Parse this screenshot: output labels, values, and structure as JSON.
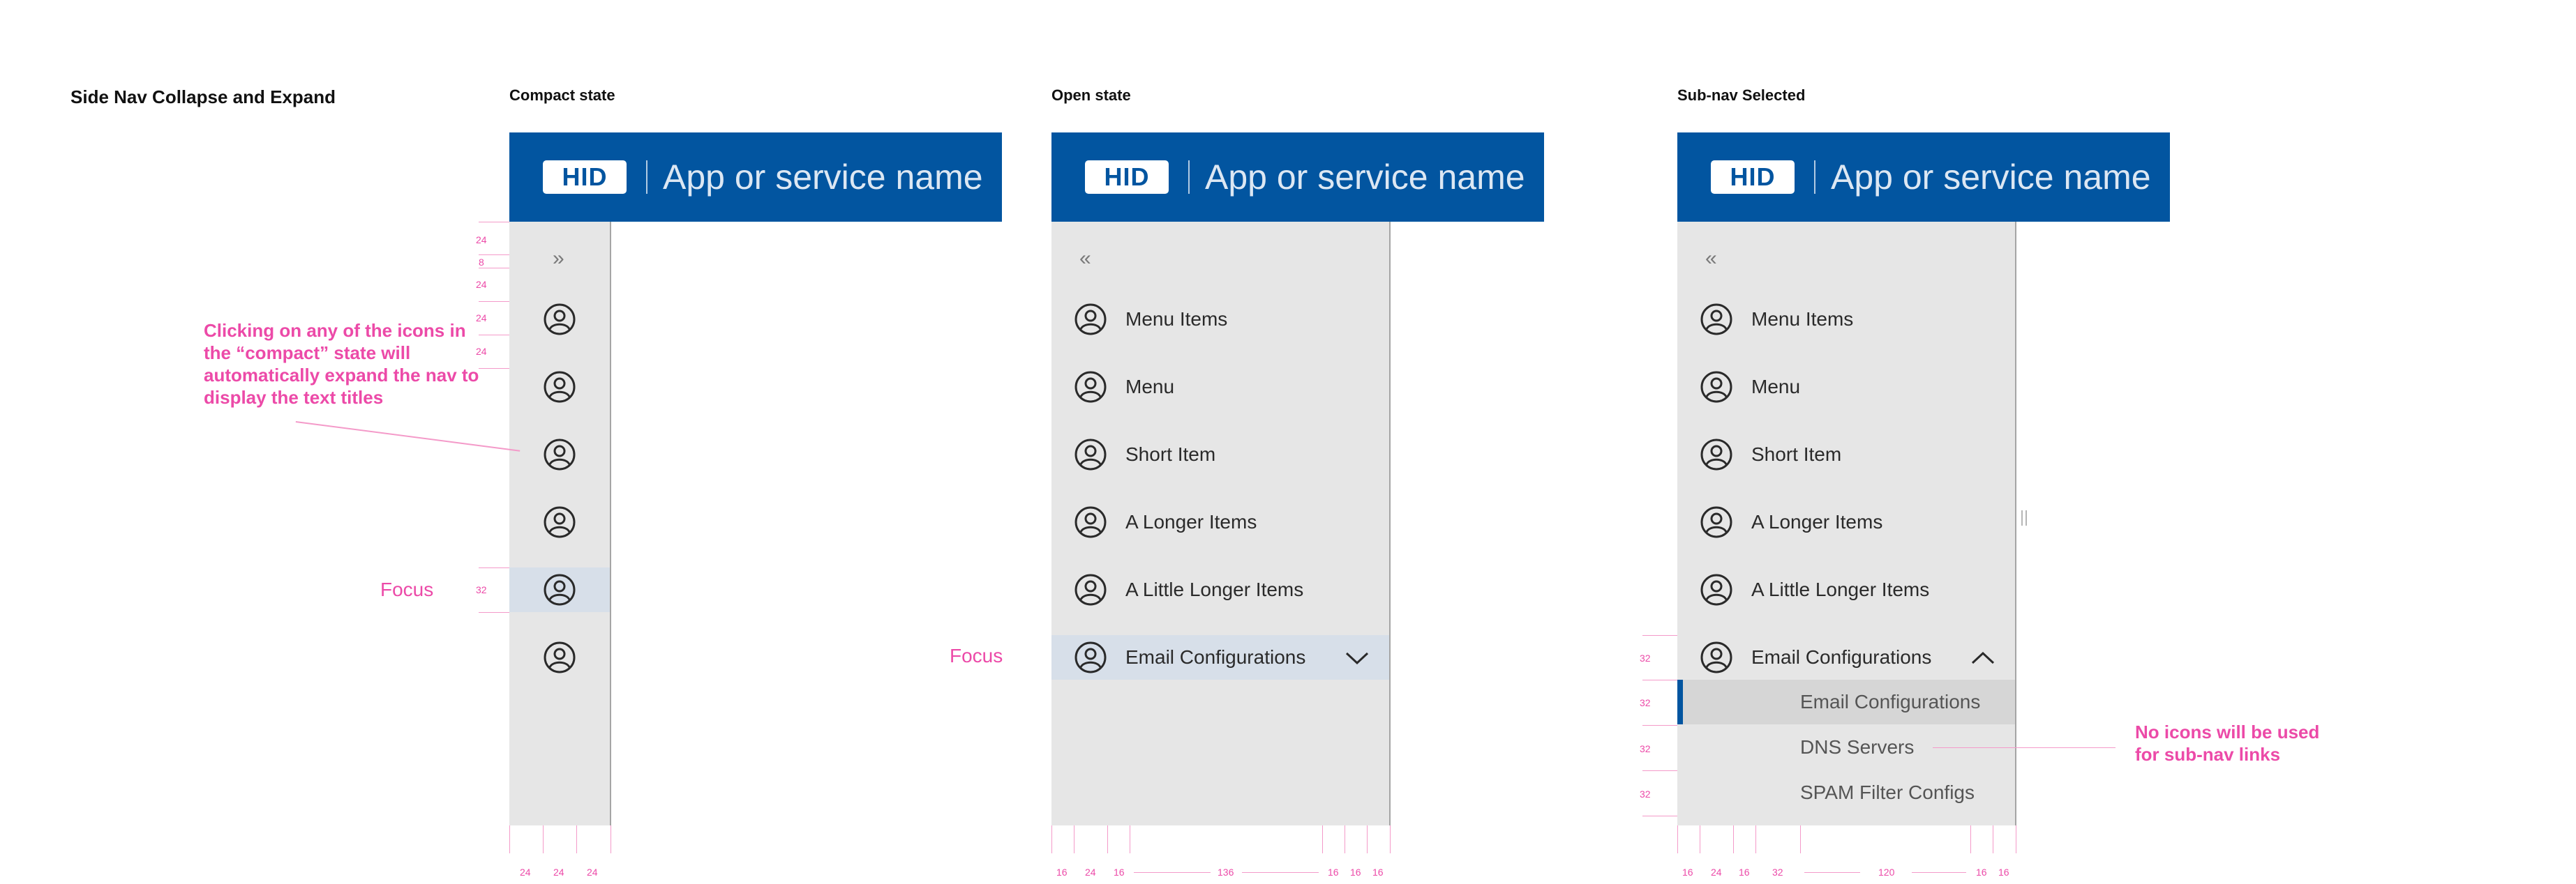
{
  "page_title": "Side Nav Collapse and Expand",
  "colors": {
    "brand": "#0255a0",
    "nav_bg": "#e6e6e6",
    "focus_bg": "#d7dfe9",
    "annotation": "#ec4aa8"
  },
  "header": {
    "logo_text": "HID",
    "app_name": "App or service name"
  },
  "panels": {
    "compact": {
      "title": "Compact state",
      "expand_icon": "»"
    },
    "open": {
      "title": "Open state",
      "collapse_icon": "«",
      "items": [
        "Menu Items",
        "Menu",
        "Short Item",
        "A Longer Items",
        "A Little Longer Items",
        "Email Configurations"
      ]
    },
    "subnav": {
      "title": "Sub-nav Selected",
      "collapse_icon": "«",
      "items": [
        "Menu Items",
        "Menu",
        "Short Item",
        "A Longer Items",
        "A Little Longer Items",
        "Email Configurations"
      ],
      "sub_items": [
        "Email Configurations",
        "DNS Servers",
        "SPAM Filter Configs"
      ]
    }
  },
  "annotations": {
    "compact_click": "Clicking on any of the icons in the “compact” state will automatically expand the nav to display the text titles",
    "focus": "Focus",
    "no_icons": "No icons will be used for sub-nav links"
  },
  "dims": {
    "compact_left": [
      "24",
      "8",
      "24",
      "24",
      "24"
    ],
    "compact_focus": "32",
    "compact_bottom": [
      "24",
      "24",
      "24"
    ],
    "open_bottom": [
      "16",
      "24",
      "16",
      "136",
      "16",
      "16",
      "16"
    ],
    "subnav_left": [
      "32",
      "32",
      "32",
      "32"
    ],
    "subnav_bottom": [
      "16",
      "24",
      "16",
      "32",
      "120",
      "16",
      "16"
    ]
  }
}
